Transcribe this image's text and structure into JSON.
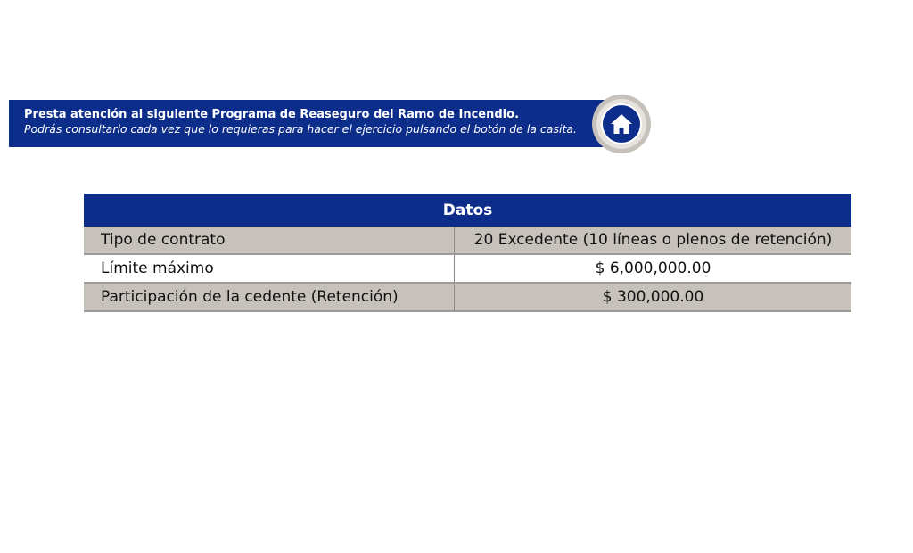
{
  "banner": {
    "title": "Presta atención al siguiente Programa de Reaseguro del Ramo de Incendio.",
    "subtitle": "Podrás consultarlo cada vez que lo requieras para hacer el ejercicio pulsando el botón de la casita.",
    "home_icon": "home-icon",
    "colors": {
      "banner_bg": "#0d2d8a",
      "ring": "#c7c1bb"
    }
  },
  "table": {
    "header": "Datos",
    "rows": [
      {
        "label": "Tipo de contrato",
        "value": "20 Excedente (10 líneas o plenos de retención)"
      },
      {
        "label": "Límite máximo",
        "value": "$ 6,000,000.00"
      },
      {
        "label": "Participación de la cedente (Retención)",
        "value": "$ 300,000.00"
      }
    ],
    "colors": {
      "header_bg": "#0d2d8a",
      "shaded_row": "#c6c1bb"
    }
  }
}
